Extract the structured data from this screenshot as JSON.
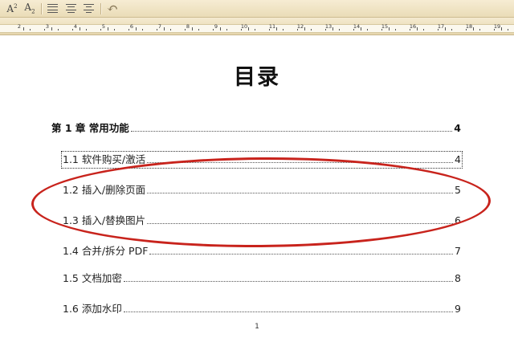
{
  "toolbar": {
    "superscript_label": "A",
    "superscript_mark": "2",
    "subscript_label": "A",
    "subscript_mark": "2",
    "undo_glyph": "↶"
  },
  "ruler": {
    "numbers": [
      "2",
      "3",
      "4",
      "5",
      "6",
      "7",
      "8",
      "9",
      "10",
      "11",
      "12",
      "13",
      "14",
      "15",
      "16",
      "17",
      "18",
      "19"
    ]
  },
  "document": {
    "title": "目录",
    "page_number": "1",
    "toc": [
      {
        "label": "第 1 章  常用功能",
        "page": "4"
      },
      {
        "label": "1.1 软件购买/激活",
        "page": "4"
      },
      {
        "label": "1.2 插入/删除页面",
        "page": "5"
      },
      {
        "label": "1.3 插入/替换图片",
        "page": "6"
      },
      {
        "label": "1.4 合并/拆分 PDF",
        "page": "7"
      },
      {
        "label": "1.5 文档加密",
        "page": "8"
      },
      {
        "label": "1.6 添加水印",
        "page": "9"
      }
    ]
  },
  "colors": {
    "highlight": "#c8231c",
    "toolbar_bg": "#eadcb7"
  }
}
